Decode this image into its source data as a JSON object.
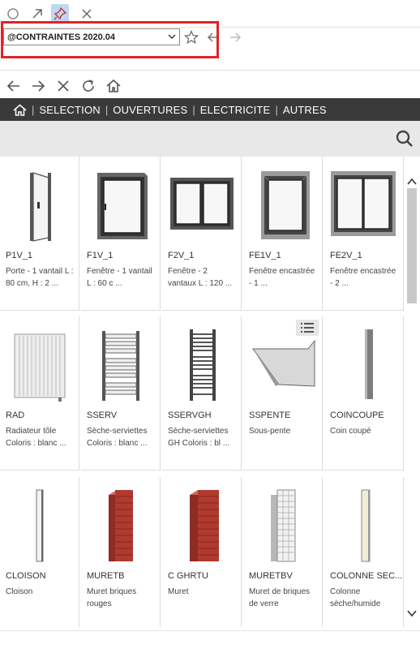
{
  "toolbar": {
    "library_value": "@CONTRAINTES 2020.04"
  },
  "menu": {
    "items": [
      "SELECTION",
      "OUVERTURES",
      "ELECTRICITE",
      "AUTRES"
    ],
    "separator": "|"
  },
  "catalog": {
    "items": [
      {
        "code": "P1V_1",
        "desc": "Porte - 1 vantail L : 80 cm, H : 2 ..."
      },
      {
        "code": "F1V_1",
        "desc": "Fenêtre - 1 vantail L : 60 c ..."
      },
      {
        "code": "F2V_1",
        "desc": "Fenêtre - 2 vantaux L : 120 ..."
      },
      {
        "code": "FE1V_1",
        "desc": "Fenêtre encastrée - 1 ..."
      },
      {
        "code": "FE2V_1",
        "desc": "Fenêtre encastrée - 2 ..."
      },
      {
        "code": "RAD",
        "desc": "Radiateur tôle Coloris : blanc ..."
      },
      {
        "code": "SSERV",
        "desc": "Sèche-serviettes Coloris : blanc ..."
      },
      {
        "code": "SSERVGH",
        "desc": "Sèche-serviettes GH Coloris : bl ..."
      },
      {
        "code": "SSPENTE",
        "desc": "Sous-pente"
      },
      {
        "code": "COINCOUPE",
        "desc": "Coin coupé"
      },
      {
        "code": "CLOISON",
        "desc": "Cloison"
      },
      {
        "code": "MURETB",
        "desc": "Muret briques rouges"
      },
      {
        "code": "C GHRTU",
        "desc": "Muret"
      },
      {
        "code": "MURETBV",
        "desc": "Muret de briques de verre"
      },
      {
        "code": "COLONNE SEC...",
        "desc": "Colonne sèche/humide"
      }
    ]
  },
  "colors": {
    "menu_bg": "#3a3a3a",
    "highlight": "#e0242a",
    "brick": "#b03a2e"
  }
}
